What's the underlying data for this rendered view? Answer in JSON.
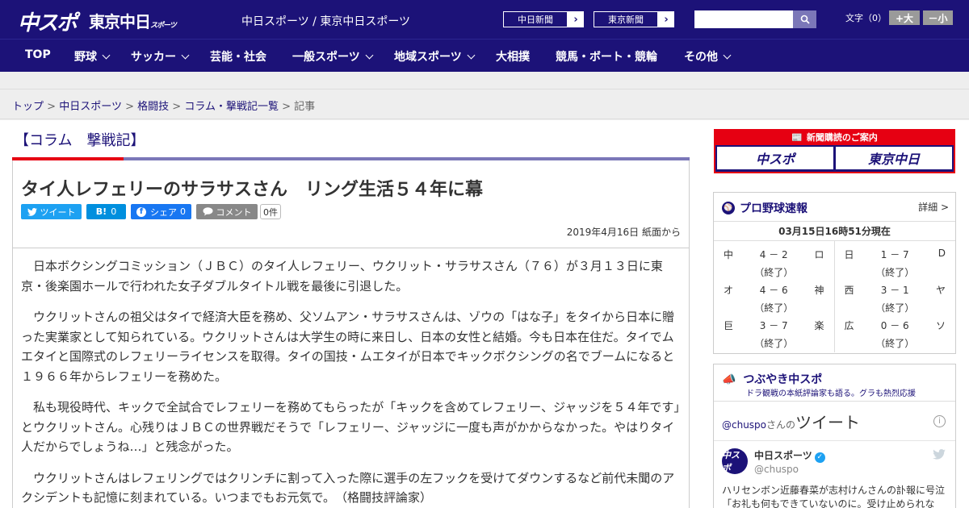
{
  "header": {
    "logo_chunichi": "中スポ",
    "logo_tokyo": "東京中日",
    "logo_tokyo_small": "スポーツ",
    "site_title": "中日スポーツ / 東京中日スポーツ",
    "paper_links": [
      {
        "label": "中日新聞"
      },
      {
        "label": "東京新聞"
      }
    ],
    "search_placeholder": "",
    "font_size_label": "文字（0）",
    "font_plus": "+大",
    "font_minus": "－小"
  },
  "nav": {
    "items": [
      {
        "label": "TOP",
        "dropdown": false
      },
      {
        "label": "野球",
        "dropdown": true
      },
      {
        "label": "サッカー",
        "dropdown": true
      },
      {
        "label": "芸能・社会",
        "dropdown": false
      },
      {
        "label": "一般スポーツ",
        "dropdown": true
      },
      {
        "label": "地域スポーツ",
        "dropdown": true
      },
      {
        "label": "大相撲",
        "dropdown": false
      },
      {
        "label": "競馬・ボート・競輪",
        "dropdown": false
      },
      {
        "label": "その他",
        "dropdown": true
      }
    ]
  },
  "breadcrumb": {
    "items": [
      "トップ",
      "中日スポーツ",
      "格闘技",
      "コラム・撃戦記一覧"
    ],
    "current": "記事",
    "separator": ">"
  },
  "article": {
    "column_title": "【コラム　撃戦記】",
    "headline": "タイ人レフェリーのサラサスさん　リング生活５４年に幕",
    "share": {
      "tweet_label": "ツイート",
      "hatena_label": "B!",
      "hatena_count": "0",
      "facebook_label": "シェア",
      "facebook_count": "0",
      "comment_label": "コメント",
      "comment_count": "0件"
    },
    "date": "2019年4月16日 紙面から",
    "paragraphs": [
      "日本ボクシングコミッション（ＪＢＣ）のタイ人レフェリー、ウクリット・サラサスさん（７６）が３月１３日に東京・後楽園ホールで行われた女子ダブルタイトル戦を最後に引退した。",
      "ウクリットさんの祖父はタイで経済大臣を務め、父ソムアン・サラサスさんは、ゾウの「はな子」をタイから日本に贈った実業家として知られている。ウクリットさんは大学生の時に来日し、日本の女性と結婚。今も日本在住だ。タイでムエタイと国際式のレフェリーライセンスを取得。タイの国技・ムエタイが日本でキックボクシングの名でブームになると１９６６年からレフェリーを務めた。",
      "私も現役時代、キックで全試合でレフェリーを務めてもらったが「キックを含めてレフェリー、ジャッジを５４年です」とウクリットさん。心残りはＪＢＣの世界戦だそうで「レフェリー、ジャッジに一度も声がかからなかった。やはりタイ人だからでしょうね…」と残念がった。",
      "ウクリットさんはレフェリングではクリンチに割って入った際に選手の左フックを受けてダウンするなど前代未聞のアクシデントも記憶に刻まれている。いつまでもお元気で。　（格闘技評論家）"
    ]
  },
  "sidebar": {
    "promo": {
      "title": "新聞購読のご案内",
      "logo_left": "中スポ",
      "logo_right": "東京中日"
    },
    "baseball": {
      "title": "プロ野球速報",
      "detail_label": "詳細 >",
      "timestamp": "03月15日16時51分現在",
      "games_left": [
        {
          "home": "中",
          "score": "4 － 2",
          "away": "ロ",
          "status": "（終了）"
        },
        {
          "home": "オ",
          "score": "4 － 6",
          "away": "神",
          "status": "（終了）"
        },
        {
          "home": "巨",
          "score": "3 － 7",
          "away": "楽",
          "status": "（終了）"
        }
      ],
      "games_right": [
        {
          "home": "日",
          "score": "1 － 7",
          "away": "D",
          "status": "（終了）"
        },
        {
          "home": "西",
          "score": "3 － 1",
          "away": "ヤ",
          "status": "（終了）"
        },
        {
          "home": "広",
          "score": "0 － 6",
          "away": "ソ",
          "status": "（終了）"
        }
      ]
    },
    "tweets": {
      "title": "つぶやき中スポ",
      "subtitle": "ドラ観戦の本紙評論家も語る。グラも熱烈応援",
      "handle": "@chuspo",
      "handle_suffix": "さんの",
      "heading": "ツイート",
      "author_name": "中日スポーツ",
      "author_handle": "@chuspo",
      "avatar_text": "中スポ",
      "text": "ハリセンボン近藤春菜が志村けんさんの訃報に号泣「お礼も何もできていないのに。受け止められな"
    }
  },
  "colors": {
    "brand_navy": "#1c1278",
    "accent_red": "#e60012",
    "twitter_blue": "#1da1f2",
    "hatena_blue": "#008fde",
    "facebook_blue": "#1877f2",
    "comment_gray": "#888888"
  }
}
